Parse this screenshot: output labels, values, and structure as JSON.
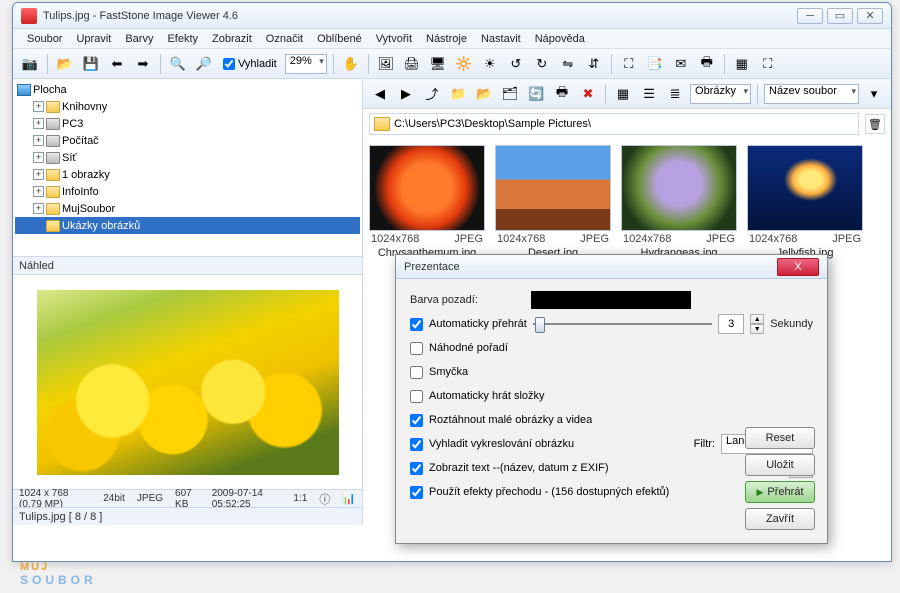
{
  "window": {
    "title": "Tulips.jpg  -  FastStone Image Viewer 4.6"
  },
  "menu": [
    "Soubor",
    "Upravit",
    "Barvy",
    "Efekty",
    "Zobrazit",
    "Označit",
    "Oblíbené",
    "Vytvořit",
    "Nástroje",
    "Nastavit",
    "Nápověda"
  ],
  "toolbar": {
    "smooth_label": "Vyhladit",
    "smooth_checked": true,
    "zoom": "29%"
  },
  "browsebar": {
    "view_filter": "Obrázky",
    "sort": "Název soubor"
  },
  "path": "C:\\Users\\PC3\\Desktop\\Sample Pictures\\",
  "tree": {
    "root": "Plocha",
    "items": [
      {
        "exp": "+",
        "icon": "fld",
        "label": "Knihovny",
        "indent": 1
      },
      {
        "exp": "+",
        "icon": "drv",
        "label": "PC3",
        "indent": 1
      },
      {
        "exp": "+",
        "icon": "drv",
        "label": "Počítač",
        "indent": 1
      },
      {
        "exp": "+",
        "icon": "drv",
        "label": "Síť",
        "indent": 1
      },
      {
        "exp": "+",
        "icon": "fld",
        "label": "1 obrazky",
        "indent": 1
      },
      {
        "exp": "+",
        "icon": "fld",
        "label": "InfoInfo",
        "indent": 1
      },
      {
        "exp": "+",
        "icon": "fld",
        "label": "MujSoubor",
        "indent": 1
      },
      {
        "exp": "",
        "icon": "fld",
        "label": "Ukázky obrázků",
        "indent": 1,
        "sel": true
      }
    ]
  },
  "preview": {
    "header": "Náhled",
    "info_dim": "1024 x 768 (0.79 MP)",
    "info_depth": "24bit",
    "info_fmt": "JPEG",
    "info_size": "607 KB",
    "info_date": "2009-07-14 05:52:25",
    "info_ratio": "1:1"
  },
  "status": "Tulips.jpg  [ 8 / 8 ]",
  "thumbs": [
    {
      "cls": "chrys",
      "dim": "1024x768",
      "fmt": "JPEG",
      "name": "Chrysanthemum.jpg"
    },
    {
      "cls": "desert",
      "dim": "1024x768",
      "fmt": "JPEG",
      "name": "Desert.jpg"
    },
    {
      "cls": "hydr",
      "dim": "1024x768",
      "fmt": "JPEG",
      "name": "Hydrangeas.jpg"
    },
    {
      "cls": "jelly",
      "dim": "1024x768",
      "fmt": "JPEG",
      "name": "Jellyfish.jpg"
    }
  ],
  "dialog": {
    "title": "Prezentace",
    "bg_label": "Barva pozadí:",
    "auto_label": "Automaticky přehrát",
    "auto_checked": true,
    "auto_value": "3",
    "auto_unit": "Sekundy",
    "random_label": "Náhodné pořadí",
    "random_checked": false,
    "loop_label": "Smyčka",
    "loop_checked": false,
    "autofolders_label": "Automaticky hrát složky",
    "autofolders_checked": false,
    "stretch_label": "Roztáhnout malé obrázky a videa",
    "stretch_checked": true,
    "smoothdraw_label": "Vyhladit vykreslování obrázku",
    "smoothdraw_checked": true,
    "filter_label": "Filtr:",
    "filter_value": "Lanczos",
    "showtext_label": "Zobrazit text --(název, datum z EXIF)",
    "showtext_checked": true,
    "fx_label": "Použít efekty přechodu   -   (156 dostupných efektů)",
    "fx_checked": true,
    "btn_reset": "Reset",
    "btn_save": "Uložit",
    "btn_play": "Přehrát",
    "btn_close": "Zavřít"
  },
  "logo": {
    "l1": "MUJ",
    "l2": "SOUBOR"
  }
}
